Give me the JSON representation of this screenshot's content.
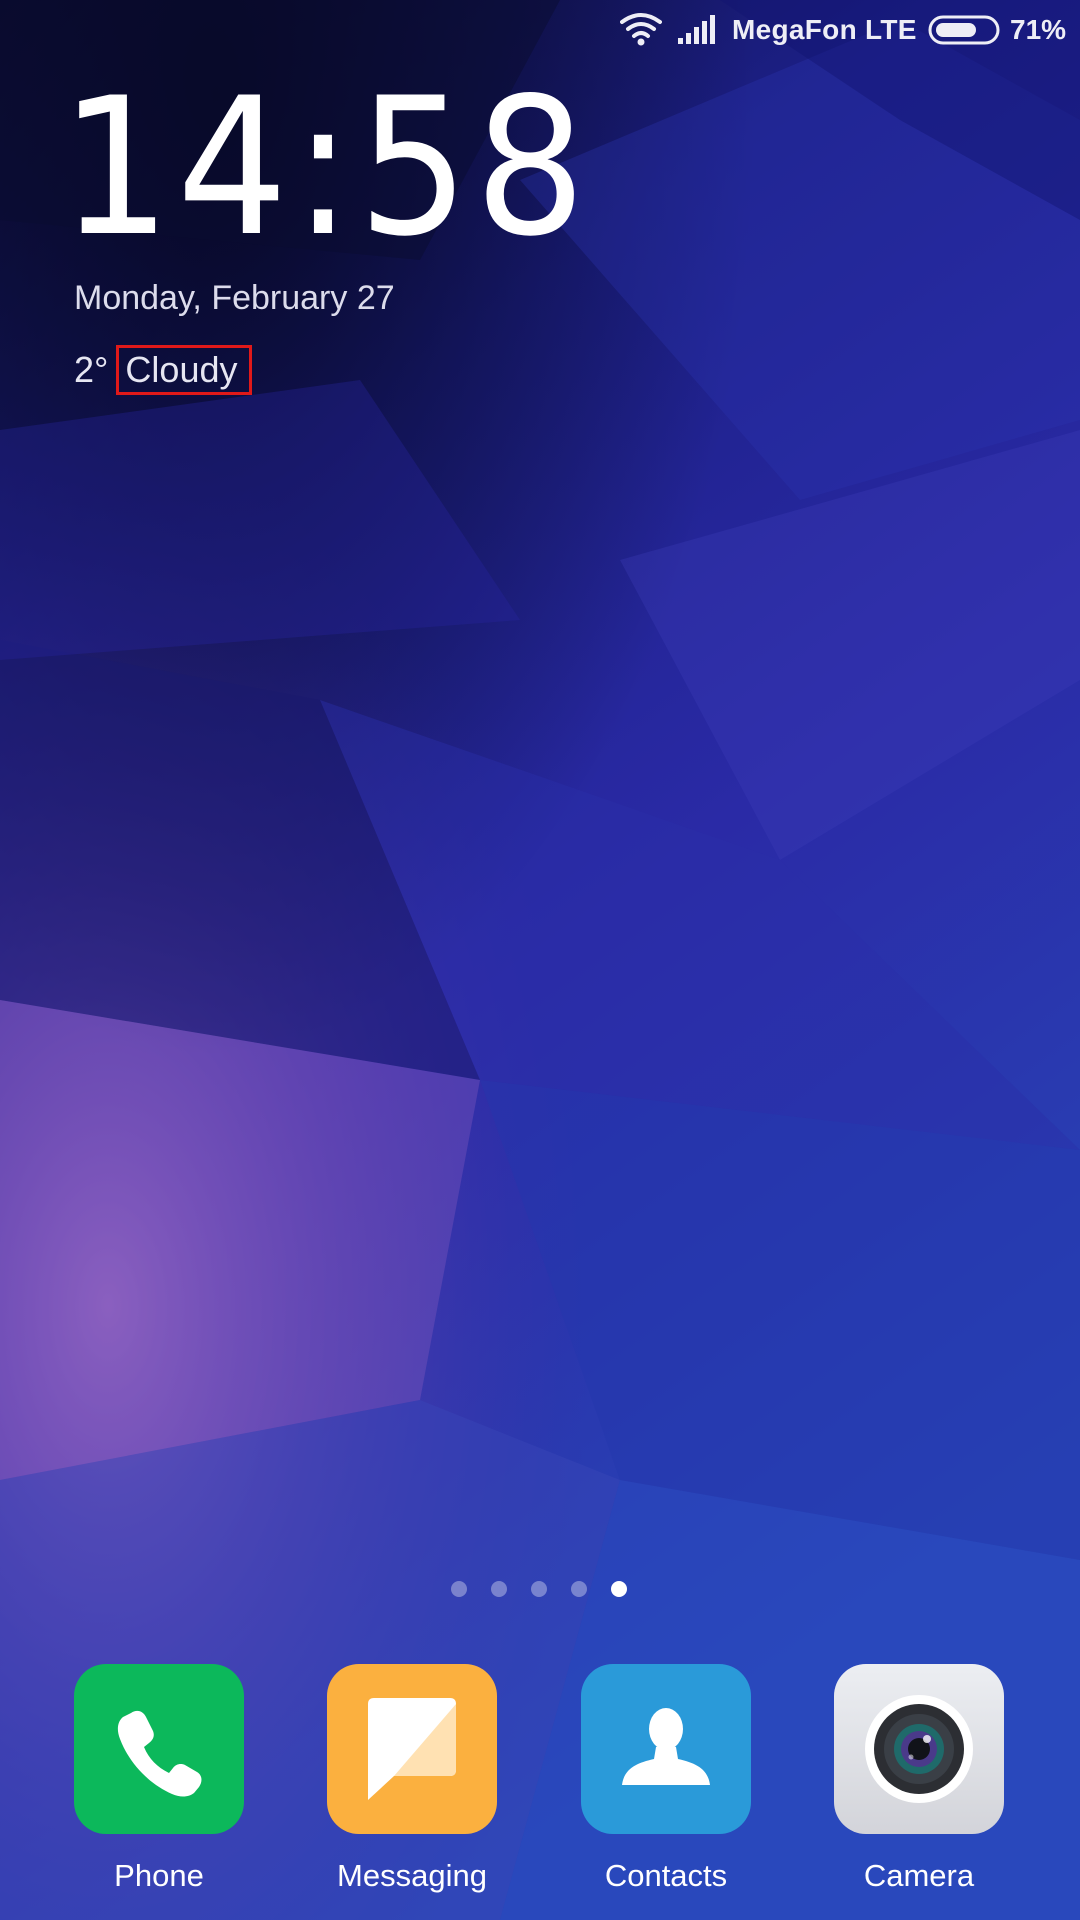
{
  "status_bar": {
    "carrier": "MegaFon LTE",
    "battery_percent": "71%",
    "battery_level": 0.71,
    "wifi_icon": "wifi-icon",
    "signal_icon": "cellular-signal-icon"
  },
  "clock_widget": {
    "time": "14:58",
    "date": "Monday, February 27",
    "temperature": "2°",
    "condition": "Cloudy",
    "condition_highlight_color": "#e01919"
  },
  "page_indicator": {
    "page_count": 5,
    "active_page": 5
  },
  "dock": [
    {
      "label": "Phone",
      "icon": "phone-icon",
      "color": "#0cb85b"
    },
    {
      "label": "Messaging",
      "icon": "messaging-icon",
      "color": "#fbb03f"
    },
    {
      "label": "Contacts",
      "icon": "contacts-icon",
      "color": "#2a9ad9"
    },
    {
      "label": "Camera",
      "icon": "camera-icon",
      "color": "#dcdde3"
    }
  ],
  "colors": {
    "wallpaper_dark": "#0f0f45",
    "wallpaper_blue": "#2633a8",
    "wallpaper_purple": "#7a4fae"
  }
}
